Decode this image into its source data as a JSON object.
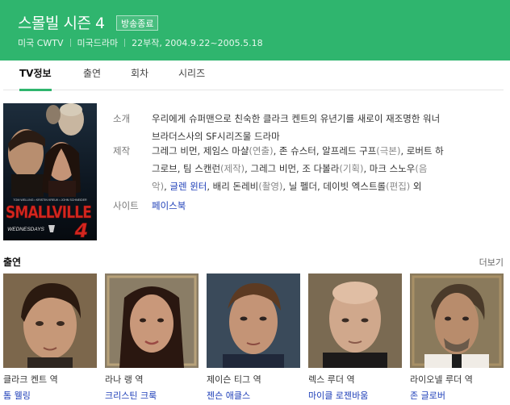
{
  "header": {
    "title": "스몰빌 시즌 4",
    "badge": "방송종료",
    "meta": [
      "미국 CWTV",
      "미국드라마",
      "22부작, 2004.9.22~2005.5.18"
    ]
  },
  "tabs": [
    {
      "label": "TV정보"
    },
    {
      "label": "출연"
    },
    {
      "label": "회차"
    },
    {
      "label": "시리즈"
    }
  ],
  "poster": {
    "top_cast": [
      "TOM WELLING",
      "KRISTIN KREUK",
      "JOHN SCHNEIDER"
    ],
    "logo": "SMALLVILLE",
    "tagline": "WEDNESDAYS",
    "number": "4"
  },
  "info": {
    "synopsis_label": "소개",
    "synopsis": [
      "우리에게 슈퍼맨으로 친숙한 클라크 켄트의 유년기를 새로이 재조명한 워너",
      "브라더스사의 SF시리즈물 드라마"
    ],
    "production_label": "제작",
    "production_lines": [
      [
        {
          "t": "그레그 비먼, 제임스 마샬"
        },
        {
          "t": "(연출)",
          "cls": "role"
        },
        {
          "t": ", 존 슈스터, 알프레드 구프"
        },
        {
          "t": "(극본)",
          "cls": "role"
        },
        {
          "t": ", 로버트 하"
        }
      ],
      [
        {
          "t": "그로브, 팀 스캔런"
        },
        {
          "t": "(제작)",
          "cls": "role"
        },
        {
          "t": ", 그레그 비먼, 조 다볼라"
        },
        {
          "t": "(기획)",
          "cls": "role"
        },
        {
          "t": ", 마크 스노우"
        },
        {
          "t": "(음",
          "cls": "role"
        }
      ],
      [
        {
          "t": "악)",
          "cls": "role"
        },
        {
          "t": ", "
        },
        {
          "t": "글렌 윈터",
          "cls": "link"
        },
        {
          "t": ", 배리 돈레비"
        },
        {
          "t": "(촬영)",
          "cls": "role"
        },
        {
          "t": ", 닐 펠더, 데이빗 엑스트롤"
        },
        {
          "t": "(편집)",
          "cls": "role"
        },
        {
          "t": " 외"
        }
      ]
    ],
    "site_label": "사이트",
    "site_link": "페이스북"
  },
  "cast": {
    "heading": "출연",
    "more": "더보기",
    "members": [
      {
        "role": "클라크 켄트 역",
        "actor": "톰 웰링"
      },
      {
        "role": "라나 랭 역",
        "actor": "크리스틴 크룩"
      },
      {
        "role": "제이슨 티그 역",
        "actor": "젠슨 애클스"
      },
      {
        "role": "렉스 루더 역",
        "actor": "마이클 로젠바움"
      },
      {
        "role": "라이오넬 루더 역",
        "actor": "존 글로버"
      }
    ]
  },
  "colors": {
    "accent": "#2fb56e",
    "link": "#1e3fb8"
  }
}
